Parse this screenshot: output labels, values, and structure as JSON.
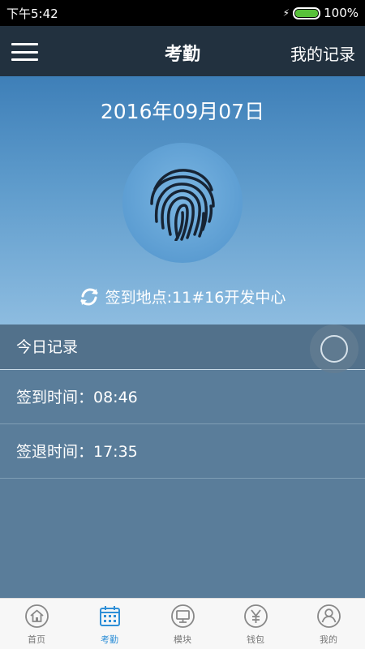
{
  "status_bar": {
    "time": "下午5:42",
    "battery": "100%",
    "battery_level": 1.0
  },
  "header": {
    "title": "考勤",
    "right_action": "我的记录"
  },
  "hero": {
    "date": "2016年09月07日",
    "location": "签到地点:11#16开发中心"
  },
  "records": {
    "title": "今日记录",
    "items": [
      {
        "label": "签到时间：08:46"
      },
      {
        "label": "签退时间：17:35"
      }
    ]
  },
  "bottom_nav": [
    {
      "label": "首页",
      "icon": "home-icon"
    },
    {
      "label": "考勤",
      "icon": "calendar-icon",
      "active": true
    },
    {
      "label": "模块",
      "icon": "monitor-icon"
    },
    {
      "label": "钱包",
      "icon": "wallet-yen-icon"
    },
    {
      "label": "我的",
      "icon": "user-icon"
    }
  ],
  "colors": {
    "header": "#22313f",
    "hero_top": "#3e7fb8",
    "hero_bottom": "#8dbce0",
    "records_background": "#5a7d9a",
    "active_tab": "#2f8fd7",
    "battery_green": "#58c13a"
  }
}
